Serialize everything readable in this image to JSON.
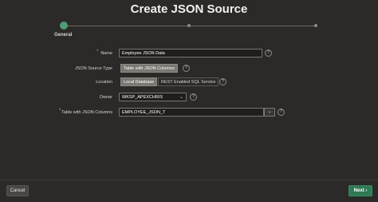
{
  "dialog": {
    "title": "Create JSON Source"
  },
  "wizard": {
    "steps": [
      {
        "label": "General"
      }
    ]
  },
  "form": {
    "name": {
      "label": "Name",
      "value": "Employee JSON Data"
    },
    "json_source_type": {
      "label": "JSON Source Type",
      "options": [
        "Table with JSON Columns"
      ],
      "selected": "Table with JSON Columns"
    },
    "location": {
      "label": "Location",
      "options": [
        "Local Database",
        "REST Enabled SQL Service"
      ],
      "selected": "Local Database"
    },
    "owner": {
      "label": "Owner",
      "value": "WKSP_APEXCHRIS"
    },
    "table": {
      "label": "Table with JSON Columns",
      "value": "EMPLOYEE_JSON_T"
    }
  },
  "footer": {
    "cancel_label": "Cancel",
    "next_label": "Next"
  },
  "icons": {
    "help": "help-icon",
    "required": "required-marker",
    "dropdown": "chevron-down-icon",
    "next": "chevron-right-icon"
  },
  "colors": {
    "accent": "#2f7a54",
    "step_active": "#4f9b73",
    "background": "#2b2a28",
    "required": "#e0a25a"
  }
}
